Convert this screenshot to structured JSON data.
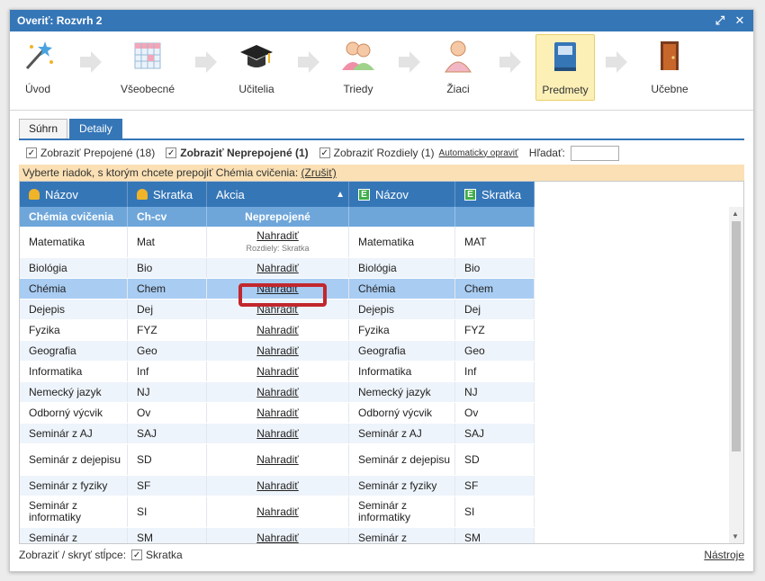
{
  "window": {
    "title": "Overiť: Rozvrh 2"
  },
  "wizard": {
    "steps": [
      {
        "label": "Úvod",
        "icon": "magic-wand-icon"
      },
      {
        "label": "Všeobecné",
        "icon": "grid-calendar-icon"
      },
      {
        "label": "Učitelia",
        "icon": "graduation-cap-icon"
      },
      {
        "label": "Triedy",
        "icon": "students-icon"
      },
      {
        "label": "Žiaci",
        "icon": "student-icon"
      },
      {
        "label": "Predmety",
        "icon": "book-icon"
      },
      {
        "label": "Učebne",
        "icon": "door-icon"
      }
    ]
  },
  "tabs": [
    {
      "label": "Súhrn"
    },
    {
      "label": "Detaily"
    }
  ],
  "filters": {
    "linked_label": "Zobraziť Prepojené (18)",
    "unlinked_label": "Zobraziť Neprepojené (1)",
    "diff_label": "Zobraziť Rozdiely (1)",
    "auto_fix_link": "Automaticky opraviť",
    "search_label": "Hľadať:",
    "search_value": ""
  },
  "notice": {
    "text": "Vyberte riadok, s ktorým chcete prepojiť Chémia cvičenia:",
    "cancel": "(Zrušiť)"
  },
  "grid": {
    "headers": [
      "Názov",
      "Skratka",
      "Akcia",
      "Názov",
      "Skratka"
    ],
    "selected": {
      "name": "Chémia cvičenia",
      "abbr": "Ch-cv",
      "action": "Neprepojené",
      "name2": "",
      "abbr2": ""
    },
    "action_label": "Nahradiť",
    "diff_note": "Rozdiely: Skratka",
    "rows": [
      {
        "name": "Matematika",
        "abbr": "Mat",
        "name2": "Matematika",
        "abbr2": "MAT"
      },
      {
        "name": "Biológia",
        "abbr": "Bio",
        "name2": "Biológia",
        "abbr2": "Bio"
      },
      {
        "name": "Chémia",
        "abbr": "Chem",
        "name2": "Chémia",
        "abbr2": "Chem"
      },
      {
        "name": "Dejepis",
        "abbr": "Dej",
        "name2": "Dejepis",
        "abbr2": "Dej"
      },
      {
        "name": "Fyzika",
        "abbr": "FYZ",
        "name2": "Fyzika",
        "abbr2": "FYZ"
      },
      {
        "name": "Geografia",
        "abbr": "Geo",
        "name2": "Geografia",
        "abbr2": "Geo"
      },
      {
        "name": "Informatika",
        "abbr": "Inf",
        "name2": "Informatika",
        "abbr2": "Inf"
      },
      {
        "name": "Nemecký jazyk",
        "abbr": "NJ",
        "name2": "Nemecký jazyk",
        "abbr2": "NJ"
      },
      {
        "name": "Odborný výcvik",
        "abbr": "Ov",
        "name2": "Odborný výcvik",
        "abbr2": "Ov"
      },
      {
        "name": "Seminár z AJ",
        "abbr": "SAJ",
        "name2": "Seminár z AJ",
        "abbr2": "SAJ"
      },
      {
        "name": "Seminár z dejepisu",
        "abbr": "SD",
        "name2": "Seminár z dejepisu",
        "abbr2": "SD"
      },
      {
        "name": "Seminár z fyziky",
        "abbr": "SF",
        "name2": "Seminár z fyziky",
        "abbr2": "SF"
      },
      {
        "name": "Seminár z informatiky",
        "abbr": "SI",
        "name2": "Seminár z informatiky",
        "abbr2": "SI"
      },
      {
        "name": "Seminár z",
        "abbr": "SM",
        "name2": "Seminár z",
        "abbr2": "SM"
      }
    ]
  },
  "footer": {
    "toggle_label": "Zobraziť / skryť stĺpce:",
    "column_label": "Skratka",
    "tools": "Nástroje"
  },
  "colors": {
    "accent": "#3576b7",
    "selected_row": "#6ea6da",
    "highlight_row": "#a9ccf2",
    "notice": "#fae0b4",
    "red_box": "#c1272d"
  }
}
